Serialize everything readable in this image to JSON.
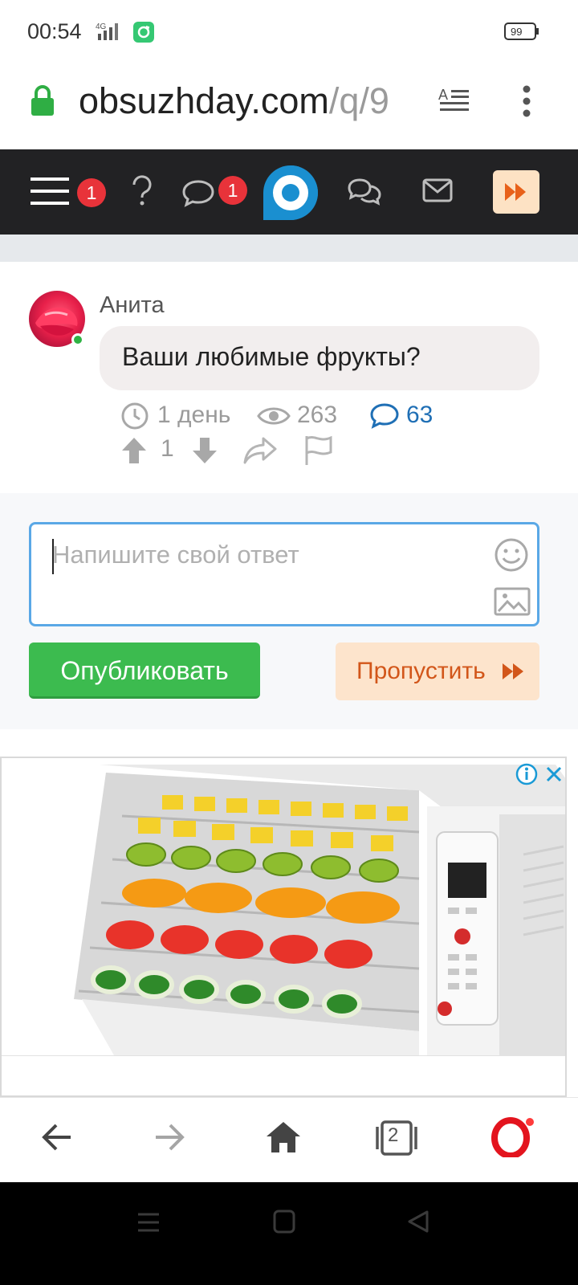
{
  "status_bar": {
    "time": "00:54",
    "network": "4G",
    "battery": "99"
  },
  "browser": {
    "url_host": "obsuzhday.com",
    "url_path": "/q/9",
    "tab_count": "2"
  },
  "site_header": {
    "menu_badge": "1",
    "messages_badge": "1"
  },
  "question": {
    "author": "Анита",
    "text": "Ваши любимые фрукты?",
    "age": "1 день",
    "views": "263",
    "comments": "63",
    "votes": "1"
  },
  "answer": {
    "placeholder": "Напишите свой ответ",
    "publish_label": "Опубликовать",
    "skip_label": "Пропустить"
  },
  "colors": {
    "header_bg": "#222224",
    "publish_green": "#3cbb4f",
    "skip_bg": "#fde4cc",
    "skip_text": "#d2561a",
    "badge_red": "#e8333a",
    "link_blue": "#1f6fb5",
    "logo_blue": "#1a8fd0"
  }
}
